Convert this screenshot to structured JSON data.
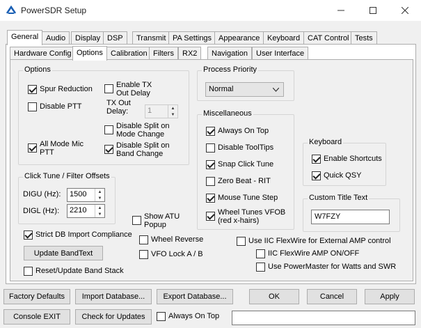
{
  "window": {
    "title": "PowerSDR Setup"
  },
  "top_tabs": [
    "General",
    "Audio",
    "Display",
    "DSP",
    "Transmit",
    "PA Settings",
    "Appearance",
    "Keyboard",
    "CAT Control",
    "Tests"
  ],
  "sub_tabs": [
    "Hardware Config",
    "Options",
    "Calibration",
    "Filters",
    "RX2",
    "Navigation",
    "User Interface"
  ],
  "options_group": {
    "title": "Options",
    "spur_reduction": "Spur Reduction",
    "disable_ptt": "Disable PTT",
    "enable_tx_out_delay": "Enable TX Out Delay",
    "tx_out_delay_label": "TX Out Delay:",
    "tx_out_delay_value": "1",
    "all_mode_mic_ptt": "All Mode Mic PTT",
    "disable_split_mode": "Disable Split on Mode Change",
    "disable_split_band": "Disable Split on Band Change"
  },
  "click_tune_group": {
    "title": "Click Tune / Filter Offsets",
    "digu_label": "DIGU (Hz):",
    "digu_value": "1500",
    "digl_label": "DIGL (Hz):",
    "digl_value": "2210"
  },
  "process_priority": {
    "title": "Process Priority",
    "selected": "Normal"
  },
  "misc_group": {
    "title": "Miscellaneous",
    "always_on_top": "Always On Top",
    "disable_tooltips": "Disable ToolTips",
    "snap_click_tune": "Snap Click Tune",
    "zero_beat": "Zero Beat -  RIT",
    "mouse_tune_step": "Mouse Tune Step",
    "wheel_tunes": "Wheel Tunes VFOB (red x-hairs)"
  },
  "keyboard_group": {
    "title": "Keyboard",
    "enable_shortcuts": "Enable Shortcuts",
    "quick_qsy": "Quick QSY"
  },
  "custom_title_group": {
    "title": "Custom Title Text",
    "value": "W7FZY"
  },
  "misc_standalone": {
    "show_atu_popup": "Show ATU Popup",
    "strict_db_import": "Strict DB Import Compliance",
    "update_bandtext": "Update BandText",
    "wheel_reverse": "Wheel Reverse",
    "vfo_lock": "VFO Lock A / B",
    "reset_band_stack": "Reset/Update Band Stack",
    "use_iic_flexwire": "Use IIC FlexWire for External AMP control",
    "iic_flexwire_amp": "IIC FlexWire AMP ON/OFF",
    "use_powermaster": "Use PowerMaster for Watts and SWR"
  },
  "bottom_buttons": {
    "factory_defaults": "Factory Defaults",
    "import_database": "Import Database...",
    "export_database": "Export Database...",
    "ok": "OK",
    "cancel": "Cancel",
    "apply": "Apply",
    "console_exit": "Console EXIT",
    "check_updates": "Check for Updates",
    "always_on_top": "Always On Top"
  }
}
